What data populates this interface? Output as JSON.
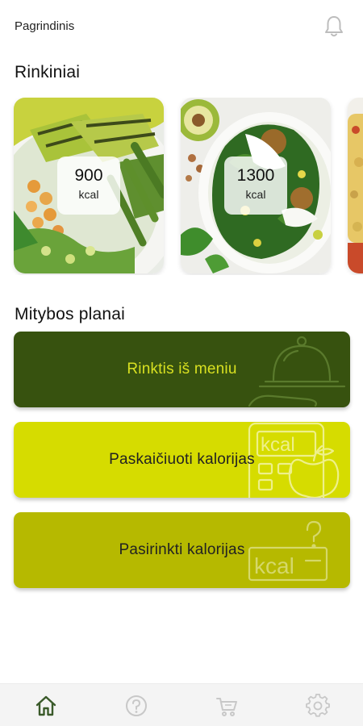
{
  "header": {
    "title": "Pagrindinis",
    "bell_icon": "bell-icon"
  },
  "sections": {
    "sets_title": "Rinkiniai",
    "plans_title": "Mitybos planai"
  },
  "sets": [
    {
      "calories": "900",
      "unit": "kcal"
    },
    {
      "calories": "1300",
      "unit": "kcal"
    },
    {
      "calories": "",
      "unit": ""
    }
  ],
  "plans": [
    {
      "label": "Rinktis iš meniu",
      "icon": "cloche-hand-icon"
    },
    {
      "label": "Paskaičiuoti kalorijas",
      "icon": "calculator-apple-icon"
    },
    {
      "label": "Pasirinkti kalorijas",
      "icon": "kcal-question-icon"
    }
  ],
  "colors": {
    "primary_dark": "#37520f",
    "primary_yellow": "#d6dc00",
    "primary_olive": "#b6b900",
    "accent_text": "#d8e021",
    "nav_active": "#3a5a2a",
    "nav_inactive": "#c8c8c8"
  },
  "bottom_nav": [
    {
      "name": "home",
      "icon": "home-icon",
      "active": true
    },
    {
      "name": "help",
      "icon": "question-icon",
      "active": false
    },
    {
      "name": "cart",
      "icon": "cart-icon",
      "active": false
    },
    {
      "name": "settings",
      "icon": "gear-icon",
      "active": false
    }
  ]
}
